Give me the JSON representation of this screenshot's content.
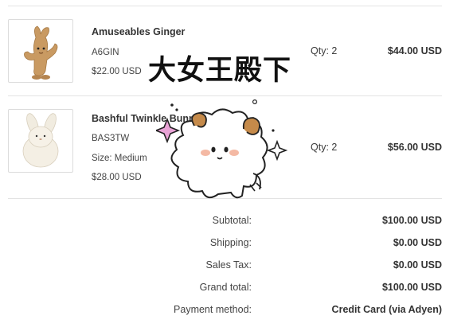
{
  "items": [
    {
      "name": "Amuseables Ginger",
      "sku": "A6GIN",
      "size": "",
      "unit_price": "$22.00 USD",
      "qty": "Qty: 2",
      "total": "$44.00 USD",
      "image_icon": "ginger-plush-icon"
    },
    {
      "name": "Bashful Twinkle Bunny",
      "sku": "BAS3TW",
      "size": "Size: Medium",
      "unit_price": "$28.00 USD",
      "qty": "Qty: 2",
      "total": "$56.00 USD",
      "image_icon": "bunny-plush-icon"
    }
  ],
  "summary": {
    "subtotal_label": "Subtotal:",
    "subtotal_value": "$100.00 USD",
    "shipping_label": "Shipping:",
    "shipping_value": "$0.00 USD",
    "tax_label": "Sales Tax:",
    "tax_value": "$0.00 USD",
    "grand_label": "Grand total:",
    "grand_value": "$100.00 USD",
    "payment_label": "Payment method:",
    "payment_value": "Credit Card (via Adyen)"
  },
  "overlay": {
    "sticker_text": "大女王殿下",
    "sticker_icon": "sheep-sticker-icon"
  },
  "colors": {
    "divider": "#e3e3e3",
    "text": "#333333",
    "sparkle_pink": "#e9a3d6",
    "sheep_horn": "#c58a4a"
  }
}
